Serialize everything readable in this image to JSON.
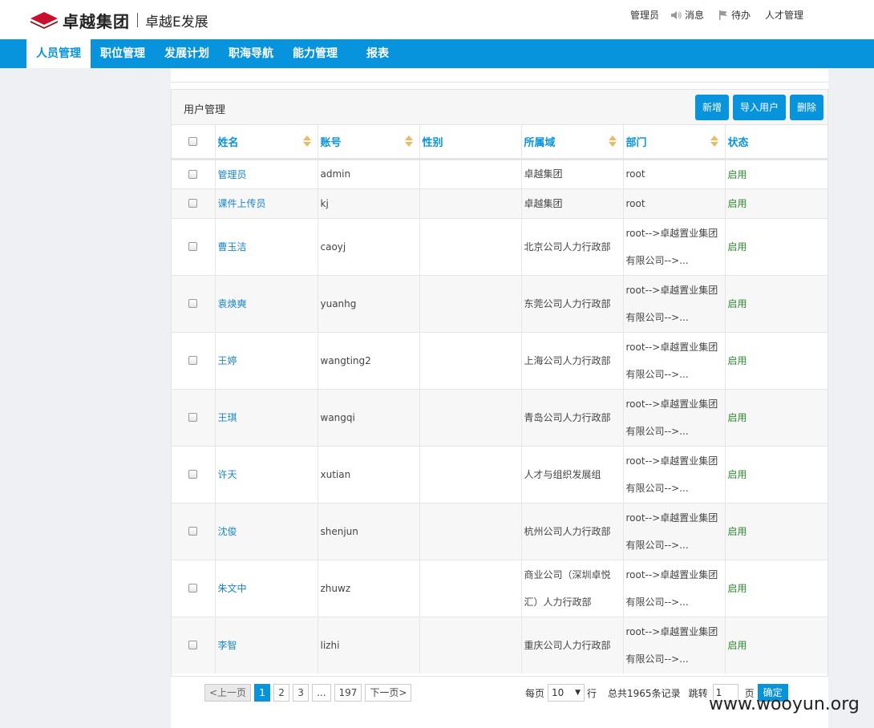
{
  "brand": {
    "logo_text": "卓越集团",
    "sub_title": "卓越E发展"
  },
  "top_links": {
    "user": "管理员",
    "messages": "消息",
    "todo": "待办",
    "talent": "人才管理"
  },
  "nav": [
    "人员管理",
    "职位管理",
    "发展计划",
    "职海导航",
    "能力管理",
    "报表"
  ],
  "panel": {
    "title": "用户管理",
    "buttons": {
      "add": "新增",
      "import": "导入用户",
      "delete": "删除"
    }
  },
  "columns": [
    "姓名",
    "账号",
    "性别",
    "所属域",
    "部门",
    "状态"
  ],
  "rows": [
    {
      "name": "管理员",
      "account": "admin",
      "gender": "",
      "domain": "卓越集团",
      "dept": "root",
      "status": "启用"
    },
    {
      "name": "课件上传员",
      "account": "kj",
      "gender": "",
      "domain": "卓越集团",
      "dept": "root",
      "status": "启用"
    },
    {
      "name": "曹玉洁",
      "account": "caoyj",
      "gender": "",
      "domain": "北京公司人力行政部",
      "dept": "root-->卓越置业集团有限公司-->...",
      "status": "启用"
    },
    {
      "name": "袁焕奭",
      "account": "yuanhg",
      "gender": "",
      "domain": "东莞公司人力行政部",
      "dept": "root-->卓越置业集团有限公司-->...",
      "status": "启用"
    },
    {
      "name": "王婷",
      "account": "wangting2",
      "gender": "",
      "domain": "上海公司人力行政部",
      "dept": "root-->卓越置业集团有限公司-->...",
      "status": "启用"
    },
    {
      "name": "王琪",
      "account": "wangqi",
      "gender": "",
      "domain": "青岛公司人力行政部",
      "dept": "root-->卓越置业集团有限公司-->...",
      "status": "启用"
    },
    {
      "name": "许天",
      "account": "xutian",
      "gender": "",
      "domain": "人才与组织发展组",
      "dept": "root-->卓越置业集团有限公司-->...",
      "status": "启用"
    },
    {
      "name": "沈俊",
      "account": "shenjun",
      "gender": "",
      "domain": "杭州公司人力行政部",
      "dept": "root-->卓越置业集团有限公司-->...",
      "status": "启用"
    },
    {
      "name": "朱文中",
      "account": "zhuwz",
      "gender": "",
      "domain": "商业公司（深圳卓悦汇）人力行政部",
      "dept": "root-->卓越置业集团有限公司-->...",
      "status": "启用"
    },
    {
      "name": "李智",
      "account": "lizhi",
      "gender": "",
      "domain": "重庆公司人力行政部",
      "dept": "root-->卓越置业集团有限公司-->...",
      "status": "启用"
    }
  ],
  "pagination": {
    "prev": "<上一页",
    "pages": [
      "1",
      "2",
      "3",
      "...",
      "197"
    ],
    "next": "下一页>",
    "per_page_label": "每页",
    "per_page_value": "10",
    "rows_unit": "行",
    "total": "总共1965条记录",
    "jump_label": "跳转",
    "jump_value": "1",
    "page_unit": "页",
    "confirm": "确定"
  },
  "watermark": "www.wooyun.org",
  "colors": {
    "primary": "#0894dc",
    "status_green": "#2d8a2d",
    "sort_arrow": "#f0b860"
  }
}
